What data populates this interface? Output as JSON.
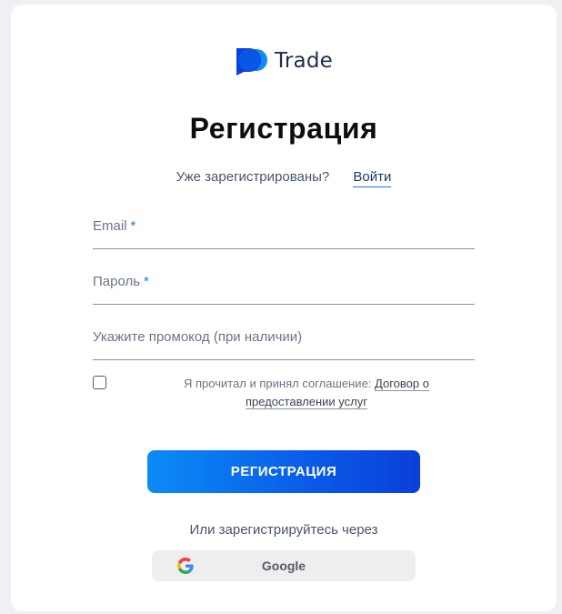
{
  "brand": {
    "name": "Trade",
    "accent": "#0a5ae8"
  },
  "header": {
    "title": "Регистрация"
  },
  "login_prompt": {
    "question": "Уже зарегистрированы?",
    "link": "Войти"
  },
  "form": {
    "email": {
      "label": "Email",
      "required_mark": "*",
      "value": ""
    },
    "password": {
      "label": "Пароль",
      "required_mark": "*",
      "value": ""
    },
    "promo": {
      "label": "Укажите промокод (при наличии)",
      "value": ""
    }
  },
  "agreement": {
    "text": "Я прочитал и принял соглашение: ",
    "link": "Договор о предоставлении услуг",
    "checked": false
  },
  "register_button": {
    "label": "РЕГИСТРАЦИЯ"
  },
  "social": {
    "prompt": "Или зарегистрируйтесь через",
    "google_label": "Google",
    "google_icon": "google-g-icon"
  }
}
